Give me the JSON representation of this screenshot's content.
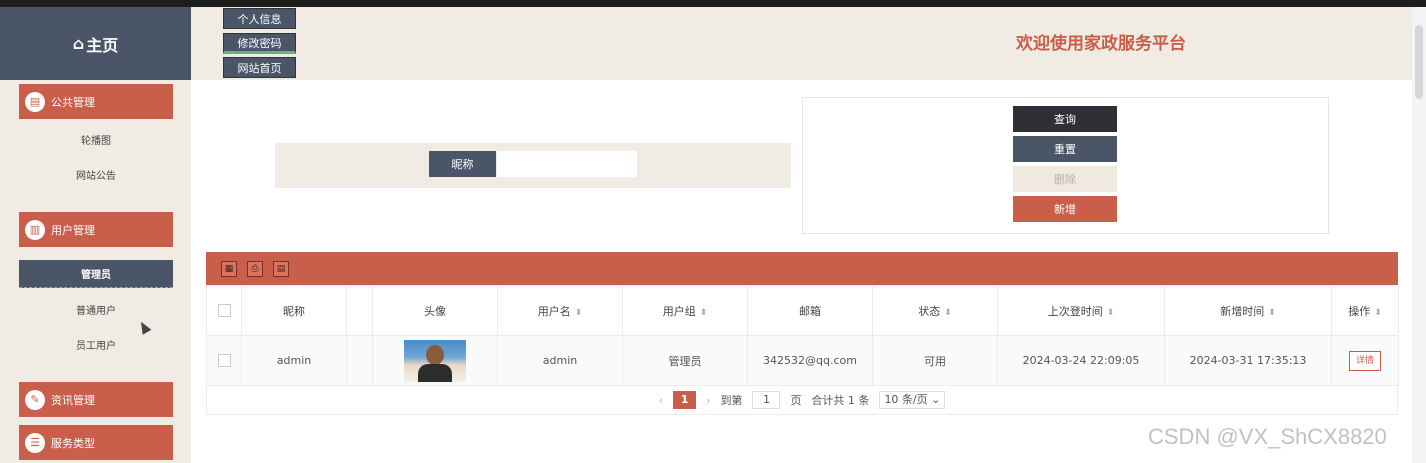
{
  "sidebar": {
    "brand": "主页",
    "brand_icon": "⌂",
    "groups": [
      {
        "label": "公共管理",
        "icon": "public-manage-icon",
        "items": [
          "轮播图",
          "网站公告"
        ]
      },
      {
        "label": "用户管理",
        "icon": "user-manage-icon",
        "items": [
          "管理员",
          "普通用户",
          "员工用户"
        ]
      },
      {
        "label": "资讯管理",
        "icon": "news-manage-icon",
        "items": []
      },
      {
        "label": "服务类型",
        "icon": "service-type-icon",
        "items": []
      }
    ]
  },
  "header": {
    "buttons": [
      "个人信息",
      "修改密码",
      "网站首页"
    ],
    "welcome": "欢迎使用家政服务平台"
  },
  "search": {
    "label": "昵称",
    "value": ""
  },
  "actions": {
    "query": "查询",
    "reset": "重置",
    "delete": "删除",
    "add": "新增"
  },
  "table": {
    "columns": [
      "昵称",
      "",
      "头像",
      "用户名",
      "用户组",
      "邮箱",
      "状态",
      "上次登时间",
      "新增时间",
      "操作"
    ],
    "rows": [
      {
        "nickname": "admin",
        "username": "admin",
        "group": "管理员",
        "email": "342532@qq.com",
        "status": "可用",
        "last_login": "2024-03-24 22:09:05",
        "created": "2024-03-31 17:35:13",
        "op": "详情"
      }
    ]
  },
  "pagination": {
    "current": "1",
    "goto_label": "到第",
    "goto_value": "1",
    "page_label": "页",
    "total": "合计共 1 条",
    "page_size": "10 条/页"
  },
  "watermark": "CSDN @VX_ShCX8820",
  "colors": {
    "accent": "#c95f4b",
    "dark": "#4b5568",
    "beige": "#f1ece3"
  }
}
